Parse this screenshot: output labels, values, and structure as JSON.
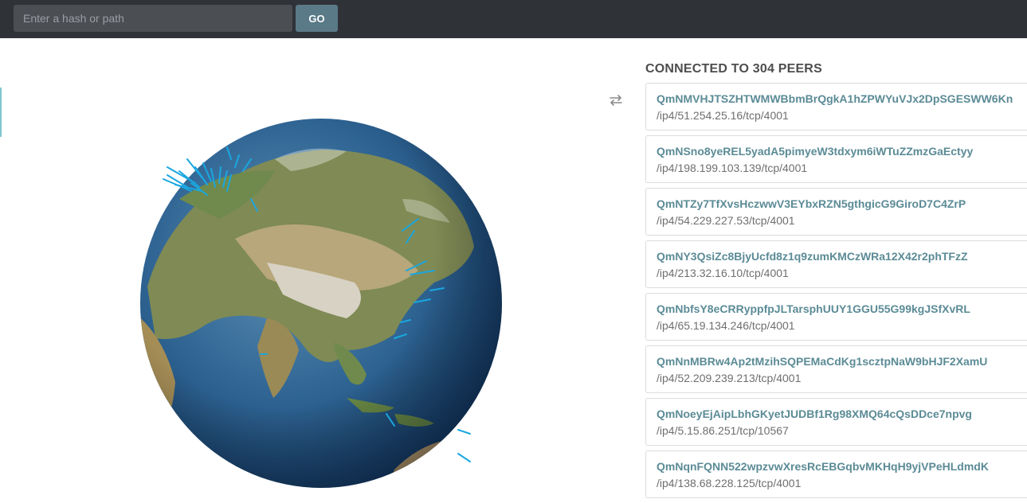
{
  "search": {
    "placeholder": "Enter a hash or path",
    "value": ""
  },
  "go_label": "GO",
  "peers": {
    "title": "CONNECTED TO 304 PEERS",
    "items": [
      {
        "id": "QmNMVHJTSZHTWMWBbmBrQgkA1hZPWYuVJx2DpSGESWW6Kn",
        "addr": "/ip4/51.254.25.16/tcp/4001"
      },
      {
        "id": "QmNSno8yeREL5yadA5pimyeW3tdxym6iWTuZZmzGaEctyy",
        "addr": "/ip4/198.199.103.139/tcp/4001"
      },
      {
        "id": "QmNTZy7TfXvsHczwwV3EYbxRZN5gthgicG9GiroD7C4ZrP",
        "addr": "/ip4/54.229.227.53/tcp/4001"
      },
      {
        "id": "QmNY3QsiZc8BjyUcfd8z1q9zumKMCzWRa12X42r2phTFzZ",
        "addr": "/ip4/213.32.16.10/tcp/4001"
      },
      {
        "id": "QmNbfsY8eCRRyppfpJLTarsphUUY1GGU55G99kgJSfXvRL",
        "addr": "/ip4/65.19.134.246/tcp/4001"
      },
      {
        "id": "QmNnMBRw4Ap2tMzihSQPEMaCdKg1scztpNaW9bHJF2XamU",
        "addr": "/ip4/52.209.239.213/tcp/4001"
      },
      {
        "id": "QmNoeyEjAipLbhGKyetJUDBf1Rg98XMQ64cQsDDce7npvg",
        "addr": "/ip4/5.15.86.251/tcp/10567"
      },
      {
        "id": "QmNqnFQNN522wpzvwXresRcEBGqbvMKHqH9yjVPeHLdmdK",
        "addr": "/ip4/138.68.228.125/tcp/4001"
      }
    ]
  },
  "icons": {
    "swap": "swap-arrows-icon",
    "globe": "globe-icon"
  },
  "colors": {
    "topbar": "#2f3338",
    "go": "#5a7a87",
    "peer_link": "#5b8b96",
    "peer_marker": "#1aa7e0"
  }
}
